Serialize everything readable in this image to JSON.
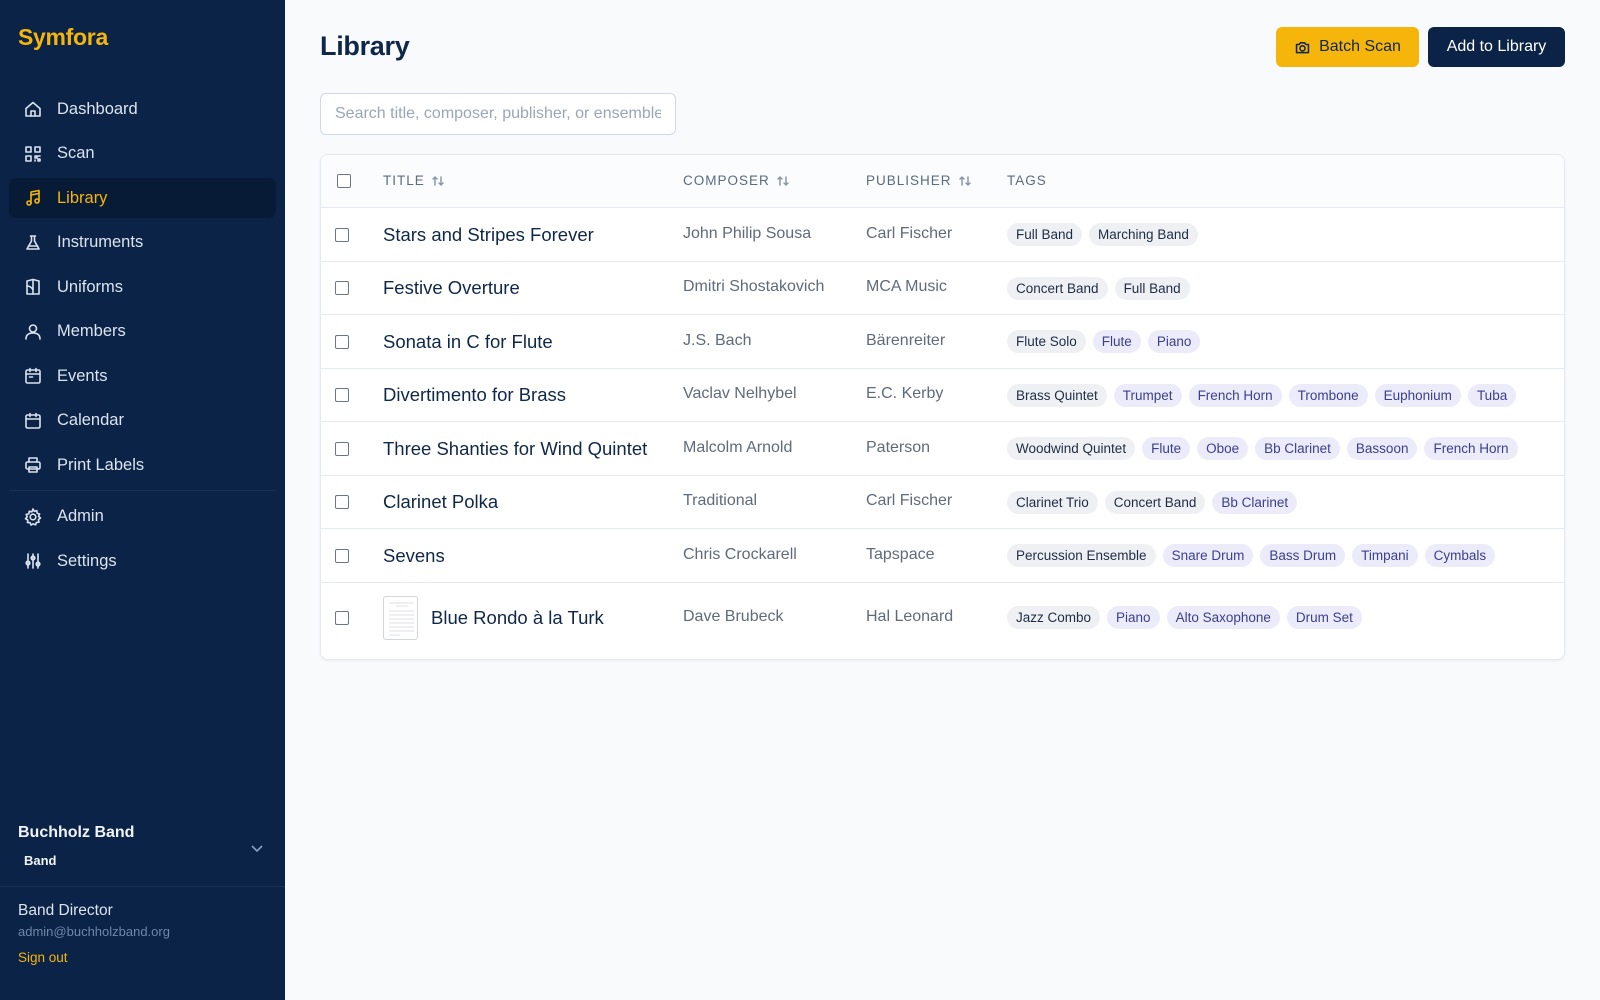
{
  "app": {
    "name": "Symfora"
  },
  "sidebar": {
    "items": [
      {
        "label": "Dashboard",
        "icon": "home-icon",
        "active": false
      },
      {
        "label": "Scan",
        "icon": "qr-scan-icon",
        "active": false
      },
      {
        "label": "Library",
        "icon": "music-note-icon",
        "active": true
      },
      {
        "label": "Instruments",
        "icon": "flask-icon",
        "active": false
      },
      {
        "label": "Uniforms",
        "icon": "shirt-icon",
        "active": false
      },
      {
        "label": "Members",
        "icon": "users-icon",
        "active": false
      },
      {
        "label": "Events",
        "icon": "calendar-event-icon",
        "active": false
      },
      {
        "label": "Calendar",
        "icon": "calendar-icon",
        "active": false
      },
      {
        "label": "Print Labels",
        "icon": "printer-icon",
        "active": false
      },
      {
        "label": "Admin",
        "icon": "gear-icon",
        "active": false
      },
      {
        "label": "Settings",
        "icon": "sliders-icon",
        "active": false
      }
    ],
    "org": {
      "name": "Buchholz Band",
      "type": "Band"
    },
    "user": {
      "role": "Band Director",
      "email": "admin@buchholzband.org",
      "sign_out": "Sign out"
    }
  },
  "header": {
    "title": "Library",
    "batch_scan_label": "Batch Scan",
    "add_label": "Add to Library"
  },
  "search": {
    "placeholder": "Search title, composer, publisher, or ensemble",
    "value": ""
  },
  "table": {
    "columns": {
      "title": "TITLE",
      "composer": "COMPOSER",
      "publisher": "PUBLISHER",
      "tags": "TAGS"
    },
    "rows": [
      {
        "title": "Stars and Stripes Forever",
        "composer": "John Philip Sousa",
        "publisher": "Carl Fischer",
        "has_thumb": false,
        "tags": [
          {
            "label": "Full Band",
            "kind": "primary"
          },
          {
            "label": "Marching Band",
            "kind": "primary"
          }
        ]
      },
      {
        "title": "Festive Overture",
        "composer": "Dmitri Shostakovich",
        "publisher": "MCA Music",
        "has_thumb": false,
        "tags": [
          {
            "label": "Concert Band",
            "kind": "primary"
          },
          {
            "label": "Full Band",
            "kind": "primary"
          }
        ]
      },
      {
        "title": "Sonata in C for Flute",
        "composer": "J.S. Bach",
        "publisher": "Bärenreiter",
        "has_thumb": false,
        "tags": [
          {
            "label": "Flute Solo",
            "kind": "primary"
          },
          {
            "label": "Flute",
            "kind": "secondary"
          },
          {
            "label": "Piano",
            "kind": "secondary"
          }
        ]
      },
      {
        "title": "Divertimento for Brass",
        "composer": "Vaclav Nelhybel",
        "publisher": "E.C. Kerby",
        "has_thumb": false,
        "tags": [
          {
            "label": "Brass Quintet",
            "kind": "primary"
          },
          {
            "label": "Trumpet",
            "kind": "secondary"
          },
          {
            "label": "French Horn",
            "kind": "secondary"
          },
          {
            "label": "Trombone",
            "kind": "secondary"
          },
          {
            "label": "Euphonium",
            "kind": "secondary"
          },
          {
            "label": "Tuba",
            "kind": "secondary"
          }
        ]
      },
      {
        "title": "Three Shanties for Wind Quintet",
        "composer": "Malcolm Arnold",
        "publisher": "Paterson",
        "has_thumb": false,
        "tags": [
          {
            "label": "Woodwind Quintet",
            "kind": "primary"
          },
          {
            "label": "Flute",
            "kind": "secondary"
          },
          {
            "label": "Oboe",
            "kind": "secondary"
          },
          {
            "label": "Bb Clarinet",
            "kind": "secondary"
          },
          {
            "label": "Bassoon",
            "kind": "secondary"
          },
          {
            "label": "French Horn",
            "kind": "secondary"
          }
        ]
      },
      {
        "title": "Clarinet Polka",
        "composer": "Traditional",
        "publisher": "Carl Fischer",
        "has_thumb": false,
        "tags": [
          {
            "label": "Clarinet Trio",
            "kind": "primary"
          },
          {
            "label": "Concert Band",
            "kind": "primary"
          },
          {
            "label": "Bb Clarinet",
            "kind": "secondary"
          }
        ]
      },
      {
        "title": "Sevens",
        "composer": "Chris Crockarell",
        "publisher": "Tapspace",
        "has_thumb": false,
        "tags": [
          {
            "label": "Percussion Ensemble",
            "kind": "primary"
          },
          {
            "label": "Snare Drum",
            "kind": "secondary"
          },
          {
            "label": "Bass Drum",
            "kind": "secondary"
          },
          {
            "label": "Timpani",
            "kind": "secondary"
          },
          {
            "label": "Cymbals",
            "kind": "secondary"
          }
        ]
      },
      {
        "title": "Blue Rondo à la Turk",
        "composer": "Dave Brubeck",
        "publisher": "Hal Leonard",
        "has_thumb": true,
        "tags": [
          {
            "label": "Jazz Combo",
            "kind": "primary"
          },
          {
            "label": "Piano",
            "kind": "secondary"
          },
          {
            "label": "Alto Saxophone",
            "kind": "secondary"
          },
          {
            "label": "Drum Set",
            "kind": "secondary"
          }
        ]
      }
    ]
  },
  "colors": {
    "sidebar_bg": "#0b2347",
    "accent": "#f5b50a",
    "primary_button": "#0b2347",
    "page_bg": "#f8fafc"
  }
}
